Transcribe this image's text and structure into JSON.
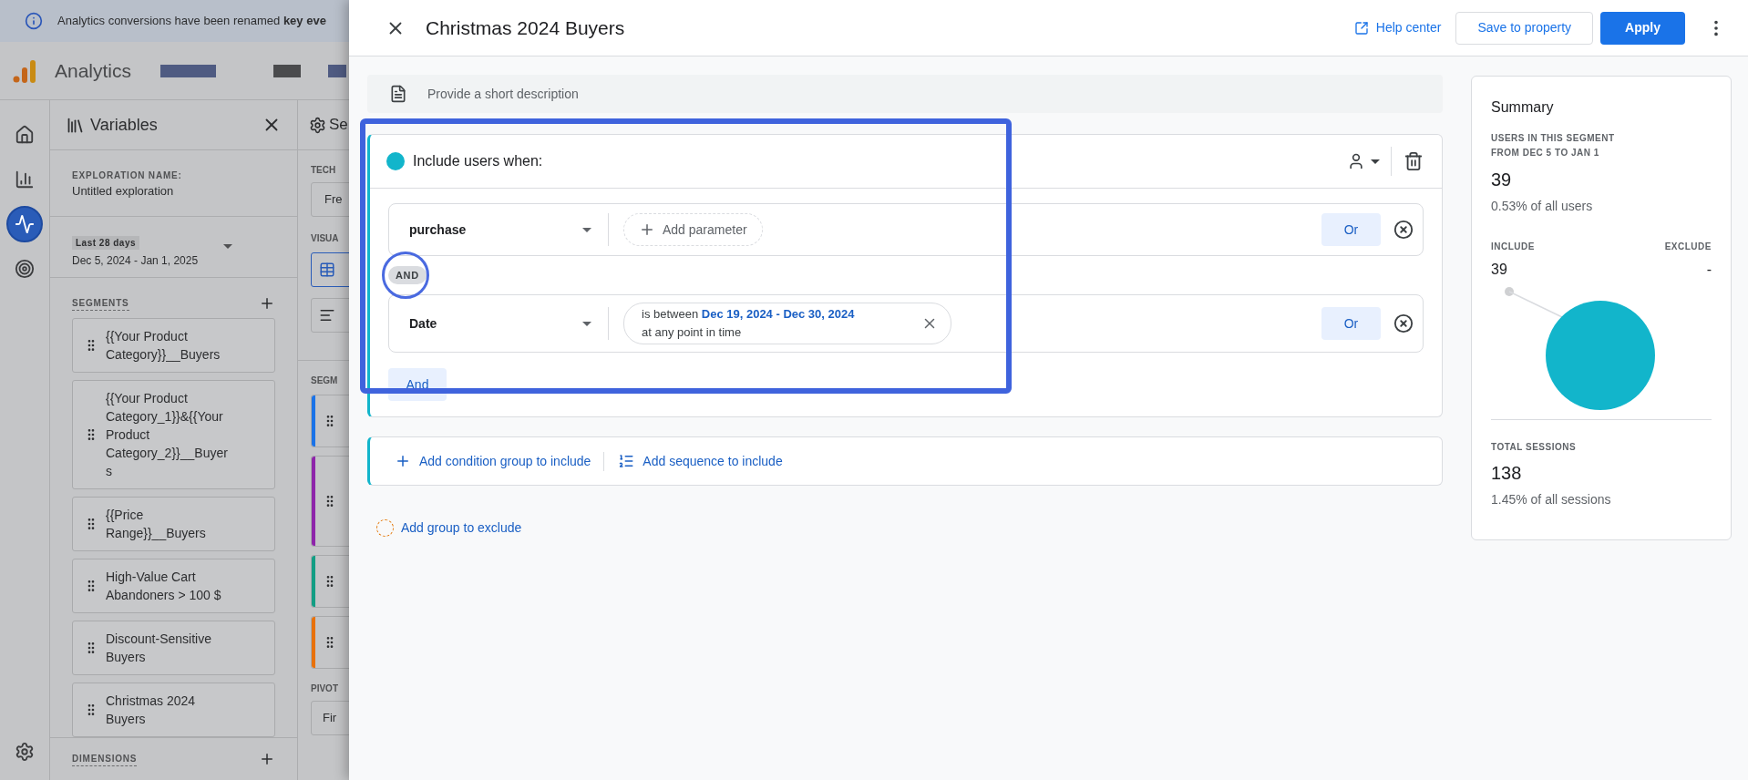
{
  "banner": {
    "text": "Analytics conversions have been renamed **key eve**"
  },
  "app": {
    "name": "Analytics"
  },
  "nav": [
    {
      "kind": "home",
      "selected": false
    },
    {
      "kind": "reports",
      "selected": false
    },
    {
      "kind": "explore",
      "selected": true
    },
    {
      "kind": "advertising",
      "selected": false
    }
  ],
  "variables": {
    "title": "Variables",
    "exploration_label": "EXPLORATION NAME:",
    "exploration_name": "Untitled exploration",
    "date_chip": "Last 28 days",
    "date_range": "Dec 5, 2024 - Jan 1, 2025",
    "segments_label": "SEGMENTS",
    "segments": [
      "{{Your Product Category}}__Buyers",
      "{{Your Product Category_1}}&{{Your Product Category_2}}__Buyers",
      "{{Price Range}}__Buyers",
      "High-Value Cart Abandoners > 100 $",
      "Discount-Sensitive Buyers",
      "Christmas 2024 Buyers"
    ],
    "dimensions_label": "DIMENSIONS"
  },
  "settings_column": {
    "title": "Se",
    "technique_label": "TECH",
    "technique_value": "Fre",
    "visualization_label": "VISUA",
    "visualizations": [
      {
        "kind": "table",
        "selected": true
      },
      {
        "kind": "bars",
        "selected": false
      }
    ],
    "segments_label": "SEGM",
    "segment_cards": [
      {
        "color": "#1a73e8"
      },
      {
        "color": "#8e24aa"
      },
      {
        "color": "#129e84"
      },
      {
        "color": "#e8710a"
      }
    ],
    "pivot_label": "PIVOT",
    "pivot_value": "Fir"
  },
  "dialog": {
    "title": "Christmas 2024 Buyers",
    "help": "Help center",
    "save": "Save to property",
    "apply": "Apply",
    "description_placeholder": "Provide a short description",
    "include_group": {
      "title": "Include users when:",
      "conditions": [
        {
          "kind": "event",
          "field": "purchase",
          "add_parameter": "Add parameter",
          "or": "Or"
        },
        {
          "kind": "date",
          "field": "Date",
          "filter_prefix": "is between",
          "filter_value": "Dec 19, 2024 - Dec 30, 2024",
          "filter_scope": "at any point in time",
          "or": "Or"
        }
      ],
      "joiner": "AND",
      "and_button": "And"
    },
    "add_condition_group": "Add condition group to include",
    "add_sequence": "Add sequence to include",
    "add_exclude": "Add group to exclude"
  },
  "summary": {
    "title": "Summary",
    "users_label": "USERS IN THIS SEGMENT",
    "users_range": "FROM DEC 5 TO JAN 1",
    "users": "39",
    "users_share": "0.53% of all users",
    "include_label": "INCLUDE",
    "exclude_label": "EXCLUDE",
    "include_value": "39",
    "exclude_value": "-",
    "sessions_label": "TOTAL SESSIONS",
    "sessions": "138",
    "sessions_share": "1.45% of all sessions"
  }
}
